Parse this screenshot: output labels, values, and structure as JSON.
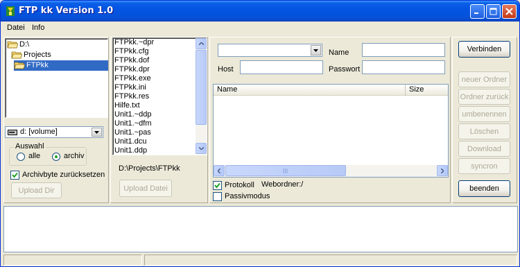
{
  "window": {
    "title": "FTP kk Version 1.0"
  },
  "menu": {
    "items": [
      "Datei",
      "Info"
    ]
  },
  "tree": {
    "items": [
      {
        "label": "D:\\",
        "selected": false
      },
      {
        "label": "Projects",
        "selected": false
      },
      {
        "label": "FTPkk",
        "selected": true
      }
    ]
  },
  "drive": {
    "selected": "d: [volume]"
  },
  "auswahl": {
    "title": "Auswahl",
    "options": [
      {
        "label": "alle",
        "checked": false
      },
      {
        "label": "archiv",
        "checked": true
      }
    ]
  },
  "archive_reset": {
    "label": "Archivbyte zurücksetzen",
    "checked": true
  },
  "upload_dir": {
    "label": "Upload Dir"
  },
  "files": {
    "items": [
      "FTPkk.~dpr",
      "FTPkk.cfg",
      "FTPkk.dof",
      "FTPkk.dpr",
      "FTPkk.exe",
      "FTPkk.ini",
      "FTPkk.res",
      "Hilfe.txt",
      "Unit1.~ddp",
      "Unit1.~dfm",
      "Unit1.~pas",
      "Unit1.dcu",
      "Unit1.ddp"
    ],
    "current_path": "D:\\Projects\\FTPkk"
  },
  "upload_file": {
    "label": "Upload Datei"
  },
  "connection": {
    "host_combo_value": "",
    "host_label": "Host",
    "host_value": "",
    "name_label": "Name",
    "name_value": "",
    "password_label": "Passwort",
    "password_value": ""
  },
  "remote_list": {
    "columns": [
      "Name",
      "Size"
    ]
  },
  "options": {
    "protokoll": {
      "label": "Protokoll",
      "checked": true
    },
    "webordner": "Webordner:/",
    "passiv": {
      "label": "Passivmodus",
      "checked": false
    }
  },
  "buttons": {
    "verbinden": "Verbinden",
    "neuer_ordner": "neuer Ordner",
    "ordner_zurueck": "Ordner zurück",
    "umbenennen": "umbenennen",
    "loeschen": "Löschen",
    "download": "Download",
    "syncron": "syncron",
    "beenden": "beenden"
  },
  "colors": {
    "titlebar": "#0554e3",
    "selection": "#316ac5",
    "face": "#ece9d8"
  }
}
